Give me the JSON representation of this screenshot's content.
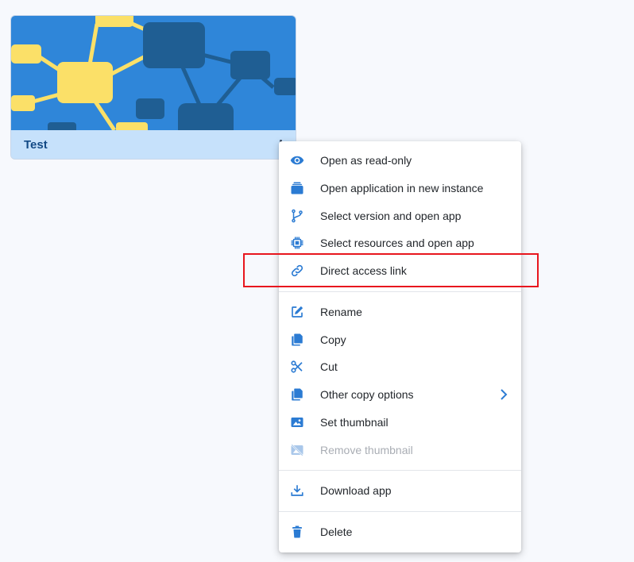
{
  "card": {
    "title": "Test",
    "thumbnail_colors": {
      "background": "#2f86d9",
      "node_yellow": "#fbe068",
      "node_dark": "#1f5e93"
    }
  },
  "menu": {
    "items": [
      {
        "label": "Open as read-only",
        "icon": "eye-icon"
      },
      {
        "label": "Open application in new instance",
        "icon": "stack-icon"
      },
      {
        "label": "Select version and open app",
        "icon": "branch-icon"
      },
      {
        "label": "Select resources and open app",
        "icon": "chip-icon"
      },
      {
        "label": "Direct access link",
        "icon": "link-icon",
        "highlighted": true
      },
      {
        "label": "Rename",
        "icon": "edit-icon"
      },
      {
        "label": "Copy",
        "icon": "copy-icon"
      },
      {
        "label": "Cut",
        "icon": "scissors-icon"
      },
      {
        "label": "Other copy options",
        "icon": "copy-icon",
        "has_submenu": true
      },
      {
        "label": "Set thumbnail",
        "icon": "image-icon"
      },
      {
        "label": "Remove thumbnail",
        "icon": "image-off-icon",
        "disabled": true
      },
      {
        "label": "Download app",
        "icon": "download-icon"
      },
      {
        "label": "Delete",
        "icon": "trash-icon"
      }
    ]
  },
  "colors": {
    "icon": "#2b7bd3",
    "icon_disabled": "#a9c7ea",
    "highlight": "#e8161e",
    "footer": "#c6e1fb",
    "title": "#134a86"
  }
}
